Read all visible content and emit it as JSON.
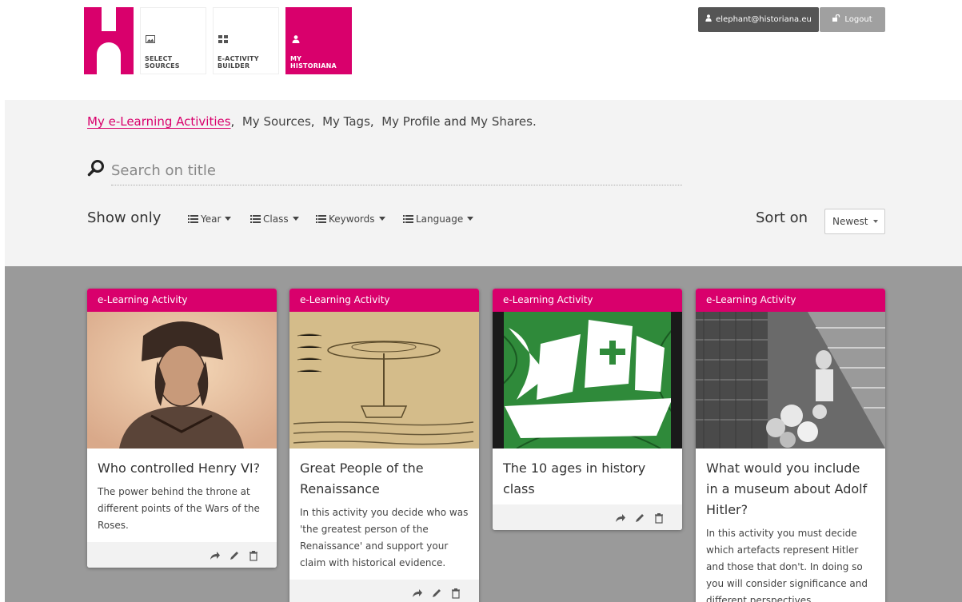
{
  "header": {
    "tiles": [
      {
        "label_line1": "SELECT",
        "label_line2": "SOURCES",
        "icon": "image-icon"
      },
      {
        "label_line1": "E-ACTIVITY",
        "label_line2": "BUILDER",
        "icon": "grid-icon"
      },
      {
        "label_line1": "MY",
        "label_line2": "HISTORIANA",
        "icon": "user-icon"
      }
    ],
    "user_email": "elephant@historiana.eu",
    "logout_label": "Logout"
  },
  "nav": {
    "links": [
      "My e-Learning Activities",
      "My Sources",
      "My Tags",
      "My Profile",
      "My Shares"
    ],
    "connector": "and"
  },
  "search": {
    "placeholder": "Search on title"
  },
  "filters": {
    "show_only_label": "Show only",
    "dropdowns": [
      "Year",
      "Class",
      "Keywords",
      "Language"
    ],
    "sort_label": "Sort on",
    "sort_value": "Newest"
  },
  "cards": [
    {
      "badge": "e-Learning Activity",
      "title": "Who controlled Henry VI?",
      "description": "The power behind the throne at different points of the Wars of the Roses."
    },
    {
      "badge": "e-Learning Activity",
      "title": "Great People of the Renaissance",
      "description": "In this activity you decide who was 'the greatest person of the Renaissance' and support your claim with historical evidence."
    },
    {
      "badge": "e-Learning Activity",
      "title": "The 10 ages in history class",
      "description": ""
    },
    {
      "badge": "e-Learning Activity",
      "title": "What would you include in a museum about Adolf Hitler?",
      "description": "In this activity you must decide which artefacts represent Hitler and those that don't. In doing so you will consider significance and different perspectives."
    }
  ],
  "colors": {
    "brand": "#d9006c",
    "grid_bg": "#9a9a9a",
    "filter_bg": "#f3f3f3"
  }
}
